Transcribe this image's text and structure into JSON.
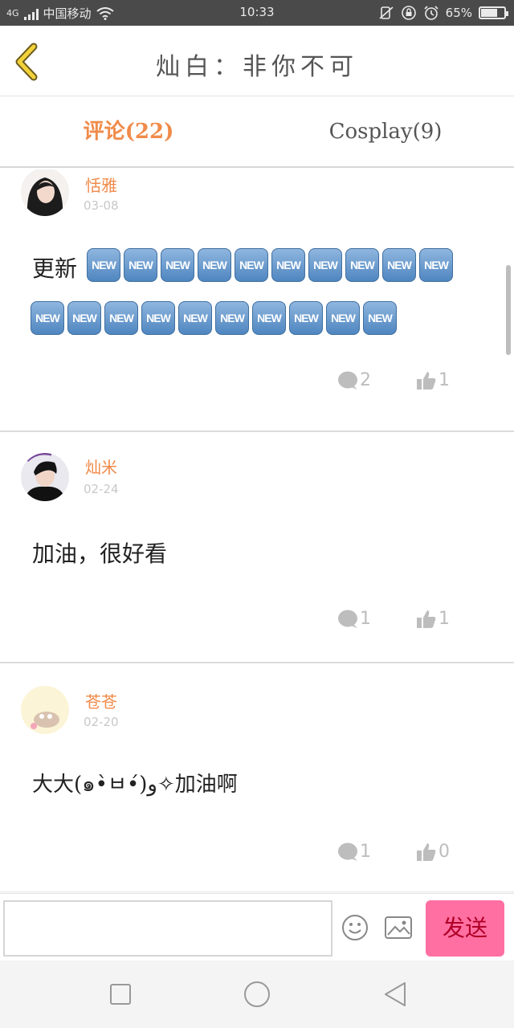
{
  "status_bar": {
    "network": "4G",
    "carrier": "中国移动",
    "time": "10:33",
    "battery_text": "65%",
    "battery_level": 0.65
  },
  "header": {
    "title": "灿白：非你不可"
  },
  "tabs": [
    {
      "label": "评论(22)",
      "active": true
    },
    {
      "label": "Cosplay(9)",
      "active": false
    }
  ],
  "comments": [
    {
      "user": "恬雅",
      "date": "03-08",
      "text": "更新",
      "badges_row1": [
        "NEW",
        "NEW",
        "NEW",
        "NEW",
        "NEW",
        "NEW",
        "NEW",
        "NEW",
        "NEW",
        "NEW"
      ],
      "badges_row2": [
        "NEW",
        "NEW",
        "NEW",
        "NEW",
        "NEW",
        "NEW",
        "NEW",
        "NEW",
        "NEW",
        "NEW"
      ],
      "reply_count": "2",
      "like_count": "1"
    },
    {
      "user": "灿米",
      "date": "02-24",
      "text": "加油，很好看",
      "reply_count": "1",
      "like_count": "1"
    },
    {
      "user": "苍苍",
      "date": "02-20",
      "text": "大大(๑•̀ㅂ•́)و✧加油啊",
      "reply_count": "1",
      "like_count": "0"
    }
  ],
  "input_bar": {
    "placeholder": "",
    "send_label": "发送",
    "send_color": "#ff6fa1"
  },
  "colors": {
    "accent": "#f08b4a",
    "status_bar": "#4a4a4a"
  }
}
